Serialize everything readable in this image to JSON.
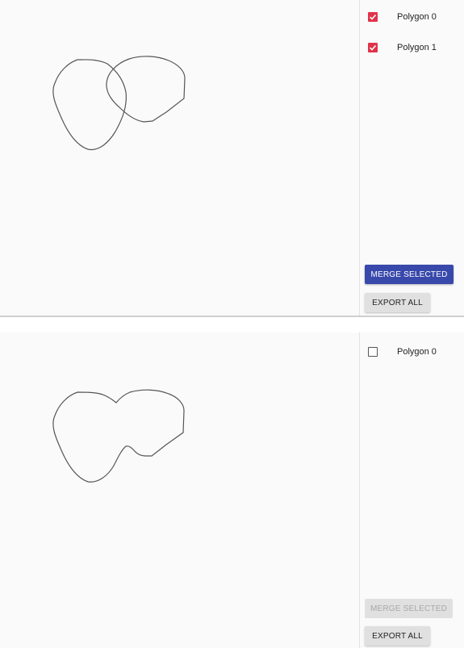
{
  "colors": {
    "accent_checked": "#e0334a",
    "merge_button": "#3949ab",
    "secondary_button": "#e0e0e0",
    "outline": "#555555"
  },
  "panels": [
    {
      "id": "before-merge",
      "polygons": [
        {
          "label": "Polygon 0",
          "checked": true
        },
        {
          "label": "Polygon 1",
          "checked": true
        }
      ],
      "merge_button": {
        "label": "MERGE SELECTED",
        "enabled": true
      },
      "export_button": {
        "label": "EXPORT ALL"
      }
    },
    {
      "id": "after-merge",
      "polygons": [
        {
          "label": "Polygon 0",
          "checked": false
        }
      ],
      "merge_button": {
        "label": "MERGE SELECTED",
        "enabled": false
      },
      "export_button": {
        "label": "EXPORT ALL"
      }
    }
  ]
}
